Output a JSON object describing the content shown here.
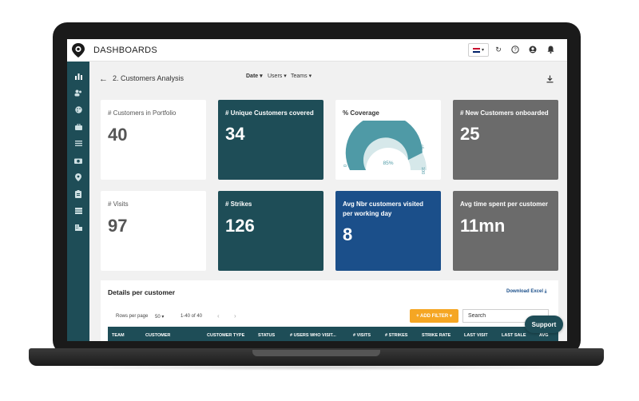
{
  "app": {
    "title": "DASHBOARDS"
  },
  "header": {
    "page_title": "2. Customers Analysis",
    "filters": [
      "Date",
      "Users",
      "Teams"
    ]
  },
  "cards": [
    {
      "label": "# Customers in Portfolio",
      "value": "40"
    },
    {
      "label": "# Unique Customers covered",
      "value": "34"
    },
    {
      "label": "% Coverage",
      "gauge_value": "85%",
      "gauge_min": "0",
      "gauge_max": "100",
      "gauge_mark": "85"
    },
    {
      "label": "# New Customers onboarded",
      "value": "25"
    },
    {
      "label": "# Visits",
      "value": "97"
    },
    {
      "label": "# Strikes",
      "value": "126"
    },
    {
      "label": "Avg Nbr customers visited per working day",
      "value": "8"
    },
    {
      "label": "Avg time spent per customer",
      "value": "11mn"
    }
  ],
  "coverage_fraction": 0.85,
  "details": {
    "title": "Details per customer",
    "download_label": "Download Excel",
    "rows_per_page_label": "Rows per page",
    "rows_per_page_value": "50",
    "range_text": "1-40 of 40",
    "add_filter_label": "+ ADD FILTER",
    "search_placeholder": "Search",
    "columns": [
      "TEAM",
      "CUSTOMER",
      "CUSTOMER TYPE",
      "STATUS",
      "# USERS WHO VISIT...",
      "# VISITS",
      "# STRIKES",
      "STRIKE RATE",
      "LAST VISIT",
      "LAST SALE",
      "AVG"
    ]
  },
  "support_label": "Support",
  "colors": {
    "teal": "#1e4d57",
    "gray": "#6b6b6b",
    "blue": "#1b4f8a",
    "orange": "#f5a623",
    "gauge": "#4f9aa6"
  },
  "icons": [
    "chart-icon",
    "users-icon",
    "palette-icon",
    "briefcase-icon",
    "list-icon",
    "camera-icon",
    "location-icon",
    "clipboard-icon",
    "table-icon",
    "building-icon"
  ]
}
